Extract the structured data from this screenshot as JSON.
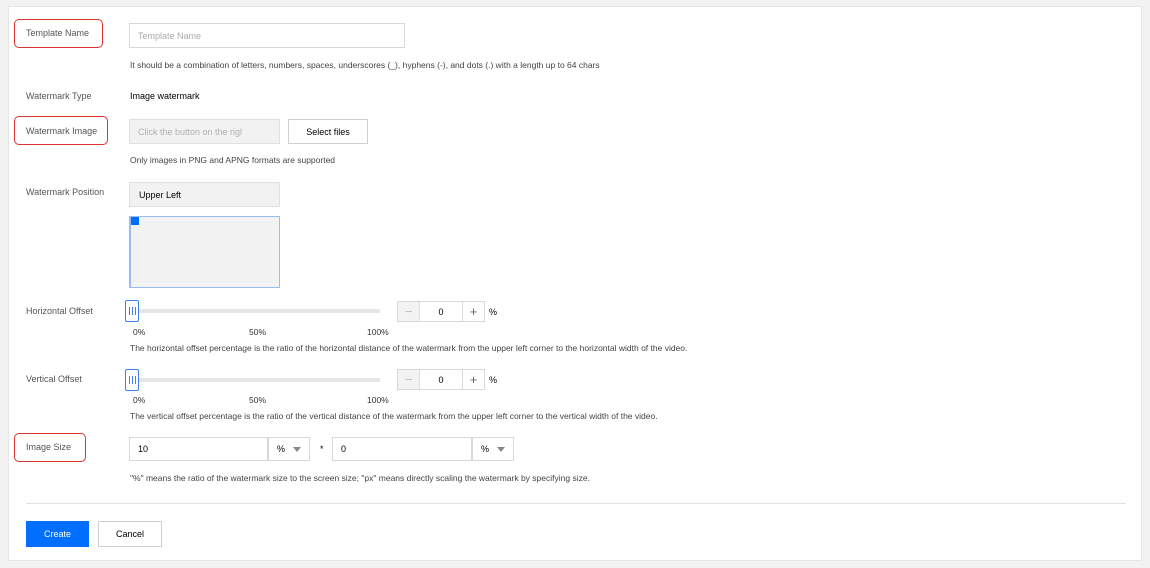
{
  "form": {
    "template_name": {
      "label": "Template Name",
      "placeholder": "Template Name",
      "value": "",
      "hint": "It should be a combination of letters, numbers, spaces, underscores (_), hyphens (-), and dots (.) with a length up to 64 chars"
    },
    "watermark_type": {
      "label": "Watermark Type",
      "value": "Image watermark"
    },
    "watermark_image": {
      "label": "Watermark Image",
      "placeholder": "Click the button on the rigl",
      "button_label": "Select files",
      "hint": "Only images in PNG and APNG formats are supported"
    },
    "watermark_position": {
      "label": "Watermark Position",
      "value": "Upper Left"
    },
    "horizontal_offset": {
      "label": "Horizontal Offset",
      "ticks": [
        "0%",
        "50%",
        "100%"
      ],
      "value": "0",
      "unit": "%",
      "slider_fraction": 0,
      "hint": "The horizontal offset percentage is the ratio of the horizontal distance of the watermark from the upper left corner to the horizontal width of the video."
    },
    "vertical_offset": {
      "label": "Vertical Offset",
      "ticks": [
        "0%",
        "50%",
        "100%"
      ],
      "value": "0",
      "unit": "%",
      "slider_fraction": 0,
      "hint": "The vertical offset percentage is the ratio of the vertical distance of the watermark from the upper left corner to the vertical width of the video."
    },
    "image_size": {
      "label": "Image Size",
      "width_value": "10",
      "width_unit": "%",
      "separator": "*",
      "height_value": "0",
      "height_unit": "%",
      "hint": "\"%\" means the ratio of the watermark size to the screen size; \"px\" means directly scaling the watermark by specifying size."
    }
  },
  "footer": {
    "create_label": "Create",
    "cancel_label": "Cancel"
  },
  "colors": {
    "primary": "#006eff",
    "highlight_box": "#e03131",
    "slider_accent": "#3d7ff0"
  }
}
